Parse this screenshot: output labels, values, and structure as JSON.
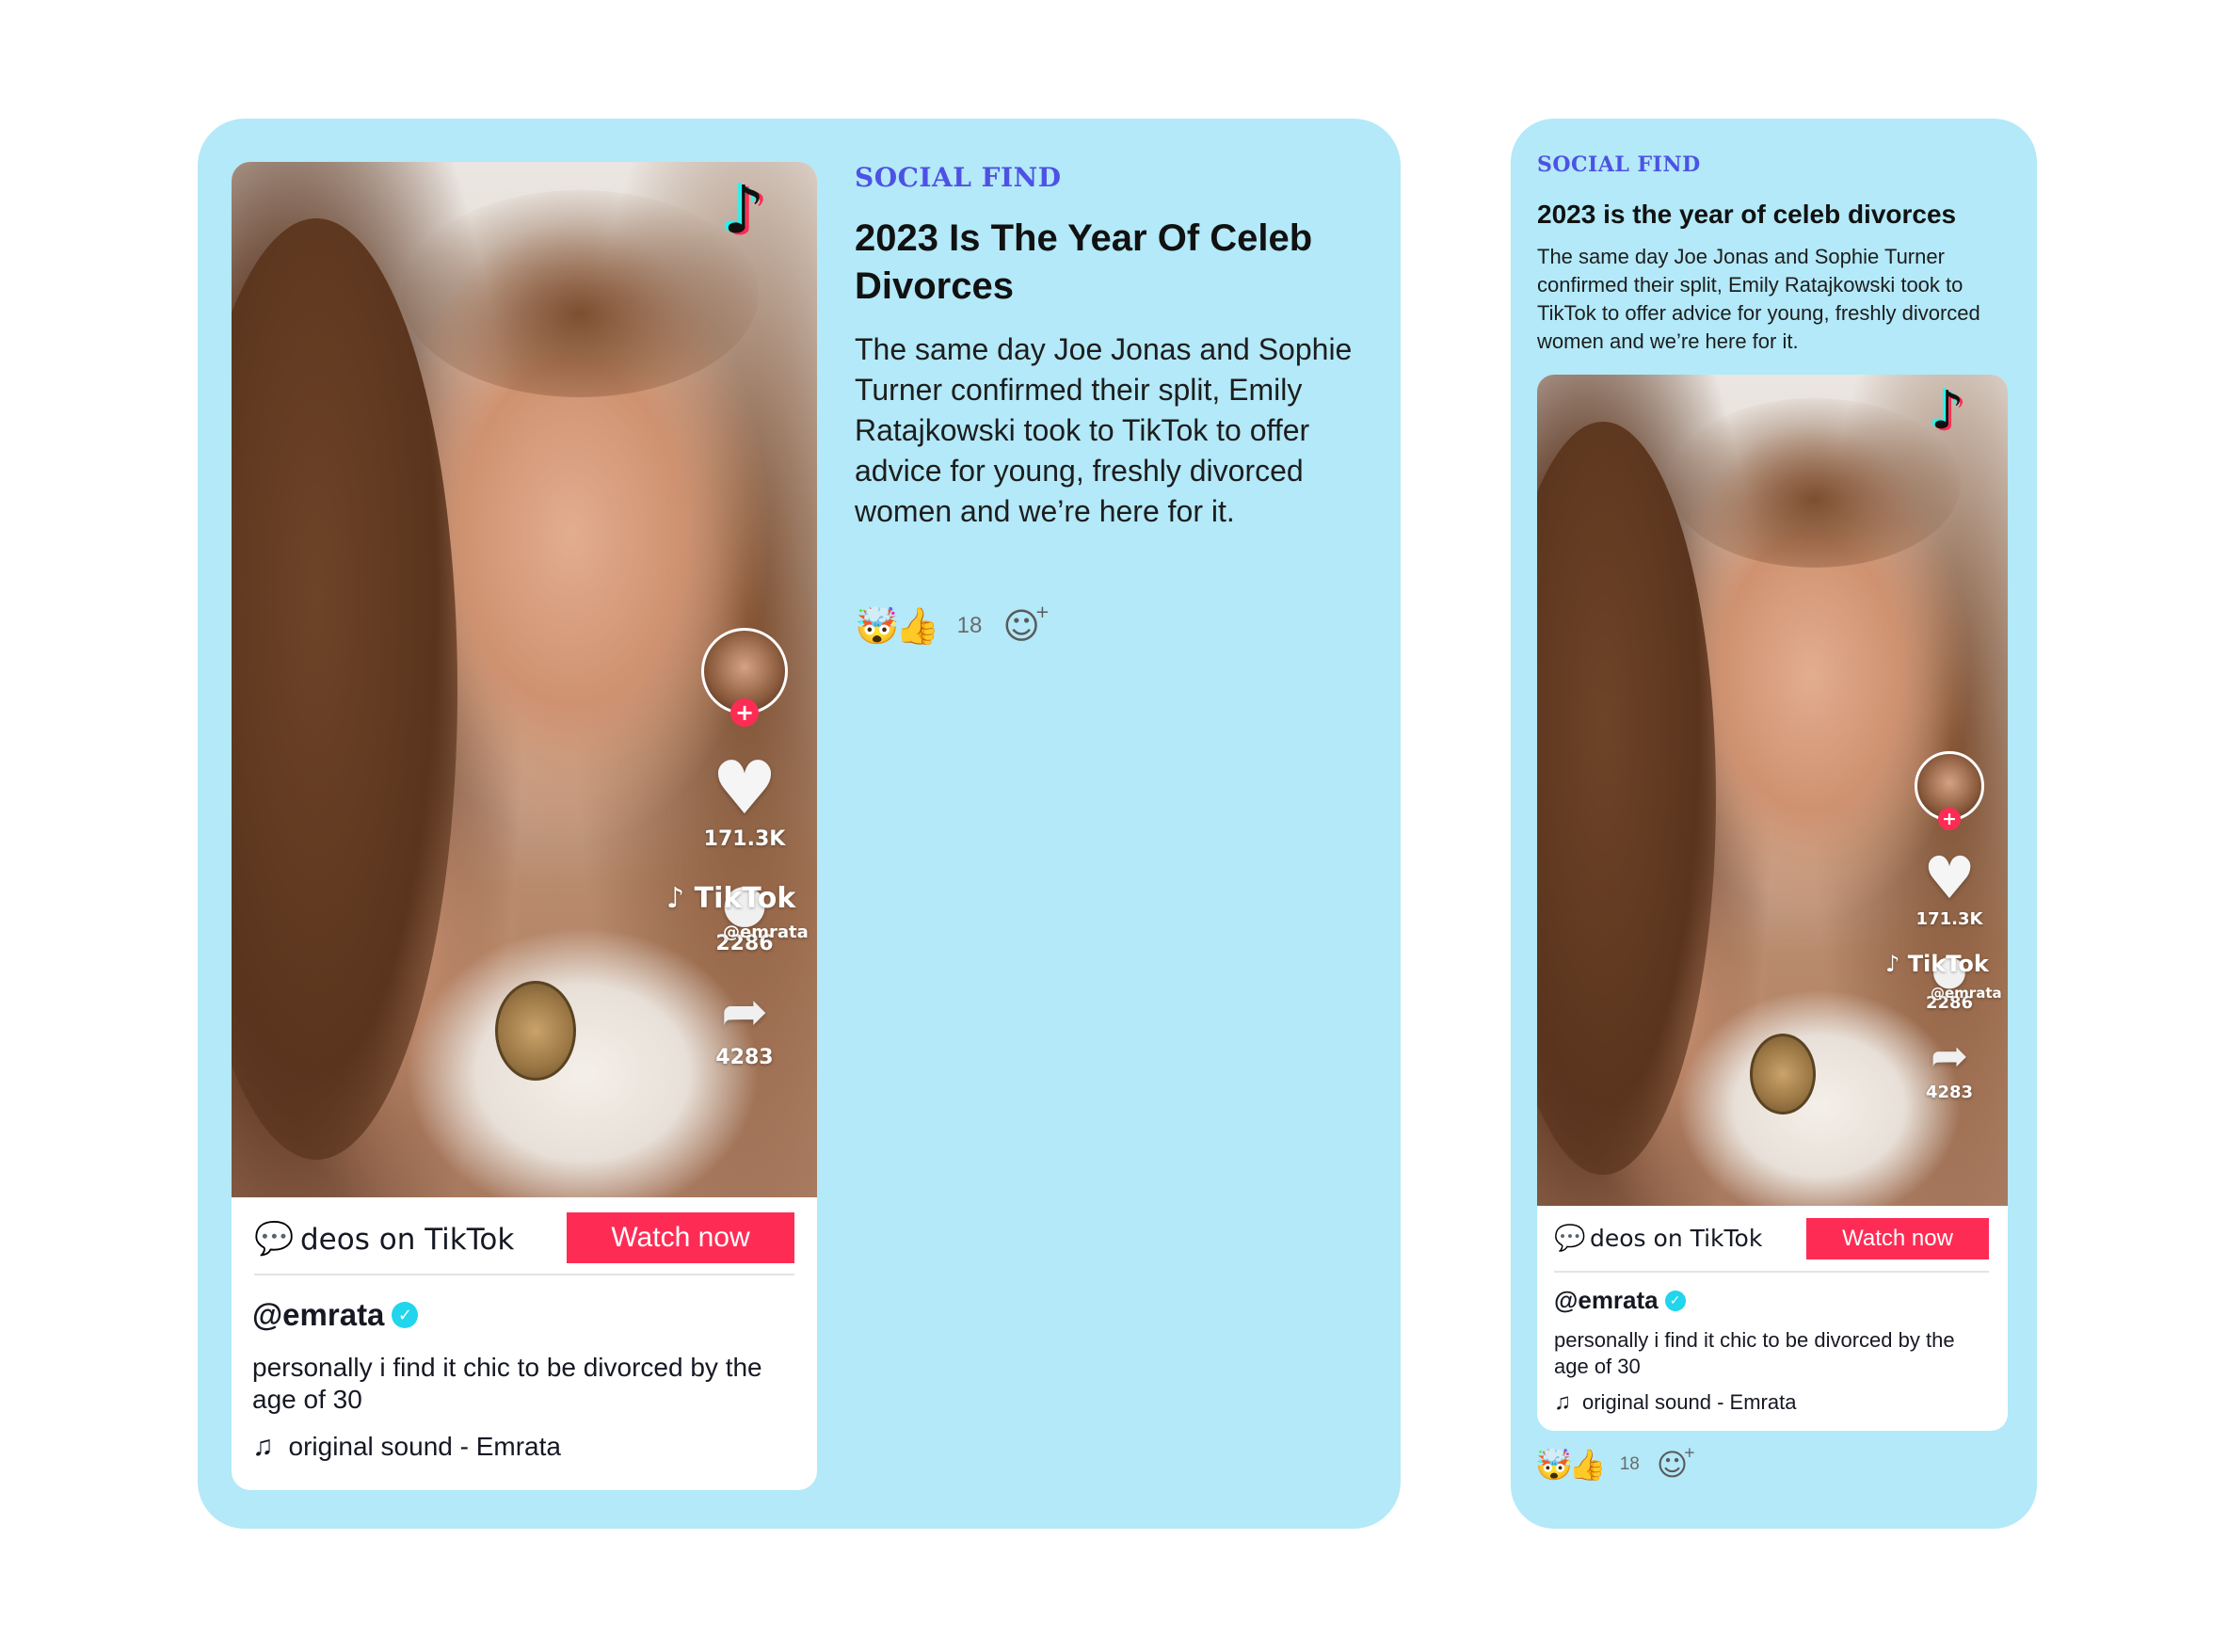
{
  "colors": {
    "card_bg": "#b3e9f8",
    "kicker": "#4d52e4",
    "watch_now_bg": "#fe2c55",
    "verified_badge": "#20d5ec"
  },
  "article": {
    "kicker": "SOCIAL FIND",
    "headline_desktop": "2023 Is The Year Of Celeb Divorces",
    "headline_mobile": "2023 is the year of celeb divorces",
    "dek": "The same day Joe Jonas and Sophie Turner confirmed their split, Emily Ratajkowski took to TikTok to offer advice for young, freshly divorced women and we’re here for it."
  },
  "reactions": {
    "emojis": [
      "🤯",
      "👍"
    ],
    "count": "18",
    "add_reaction_icon": "smiley-plus-icon"
  },
  "tiktok": {
    "logo_icon": "tiktok-note-icon",
    "watermark": "TikTok",
    "watermark_user": "@emrata",
    "likes": "171.3K",
    "comments": "2286",
    "shares": "4283",
    "follow_symbol": "+",
    "bar_text": "deos on TikTok",
    "watch_now": "Watch now",
    "handle": "@emrata",
    "caption": "personally i find it chic to be divorced by the age of 30",
    "sound": "original sound - Emrata"
  }
}
